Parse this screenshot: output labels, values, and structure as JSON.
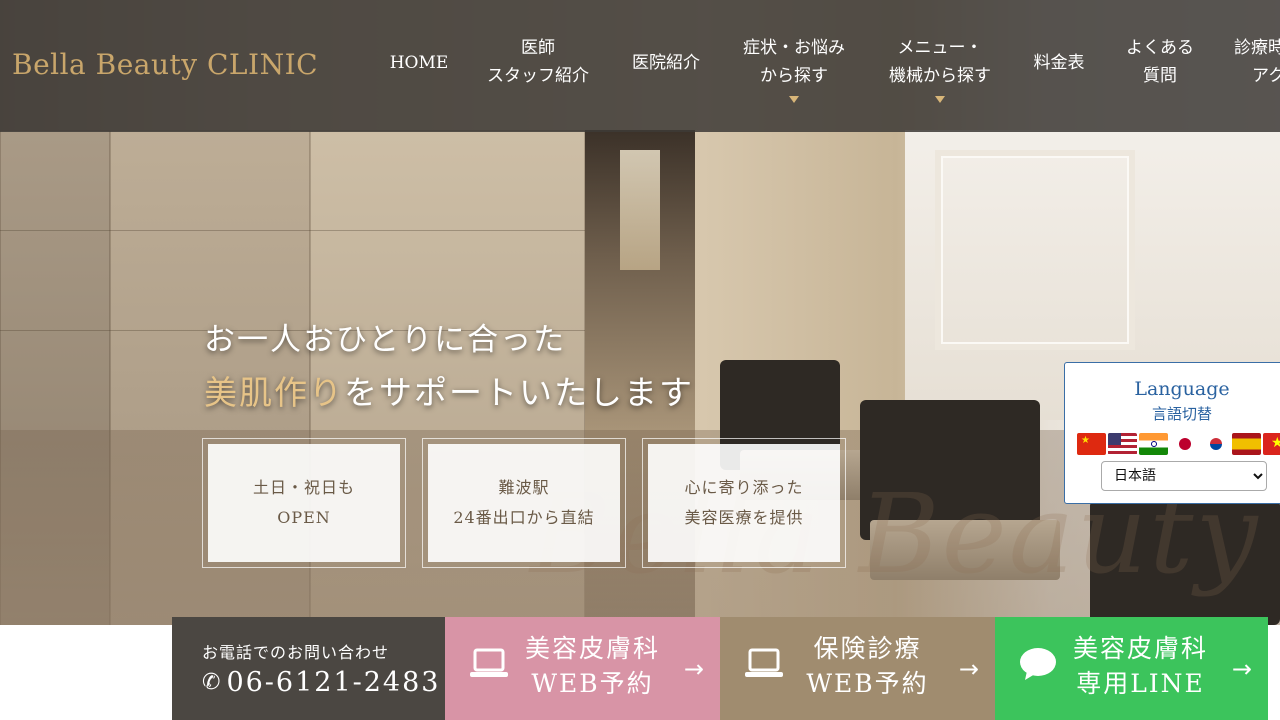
{
  "header": {
    "logo": "Bella Beauty CLINIC",
    "nav": [
      {
        "line1": "HOME",
        "line2": ""
      },
      {
        "line1": "医師",
        "line2": "スタッフ紹介"
      },
      {
        "line1": "医院紹介",
        "line2": ""
      },
      {
        "line1": "症状・お悩み",
        "line2": "から探す"
      },
      {
        "line1": "メニュー・",
        "line2": "機械から探す"
      },
      {
        "line1": "料金表",
        "line2": ""
      },
      {
        "line1": "よくある",
        "line2": "質問"
      },
      {
        "line1": "診療時",
        "line2": "アク"
      }
    ]
  },
  "hero": {
    "tagline1": "お一人おひとりに合った",
    "tagline2_em": "美肌作り",
    "tagline2_rest": "をサポートいたします",
    "watermark": "Bella Beauty Clinic",
    "features": [
      {
        "line1": "土日・祝日も",
        "line2": "OPEN"
      },
      {
        "line1": "難波駅",
        "line2": "24番出口から直結"
      },
      {
        "line1": "心に寄り添った",
        "line2": "美容医療を提供"
      }
    ]
  },
  "language": {
    "title": "Language",
    "subtitle": "言語切替",
    "flags": [
      "china-flag-icon",
      "usa-flag-icon",
      "india-flag-icon",
      "japan-flag-icon",
      "korea-flag-icon",
      "spain-flag-icon",
      "vietnam-flag-icon"
    ],
    "selected": "日本語"
  },
  "cta": {
    "phone_label": "お電話でのお問い合わせ",
    "phone_number": "06-6121-2483",
    "beauty_line1": "美容皮膚科",
    "beauty_line2": "WEB予約",
    "insurance_line1": "保険診療",
    "insurance_line2": "WEB予約",
    "line_line1": "美容皮膚科",
    "line_line2": "専用LINE",
    "arrow": "→"
  },
  "colors": {
    "header_bg": "#3e3a37",
    "logo_gold": "#c9a66b",
    "beauty_pink": "#d894a6",
    "insurance_brown": "#a08c6f",
    "line_green": "#3cc45c",
    "phone_dark": "#4b4742"
  }
}
